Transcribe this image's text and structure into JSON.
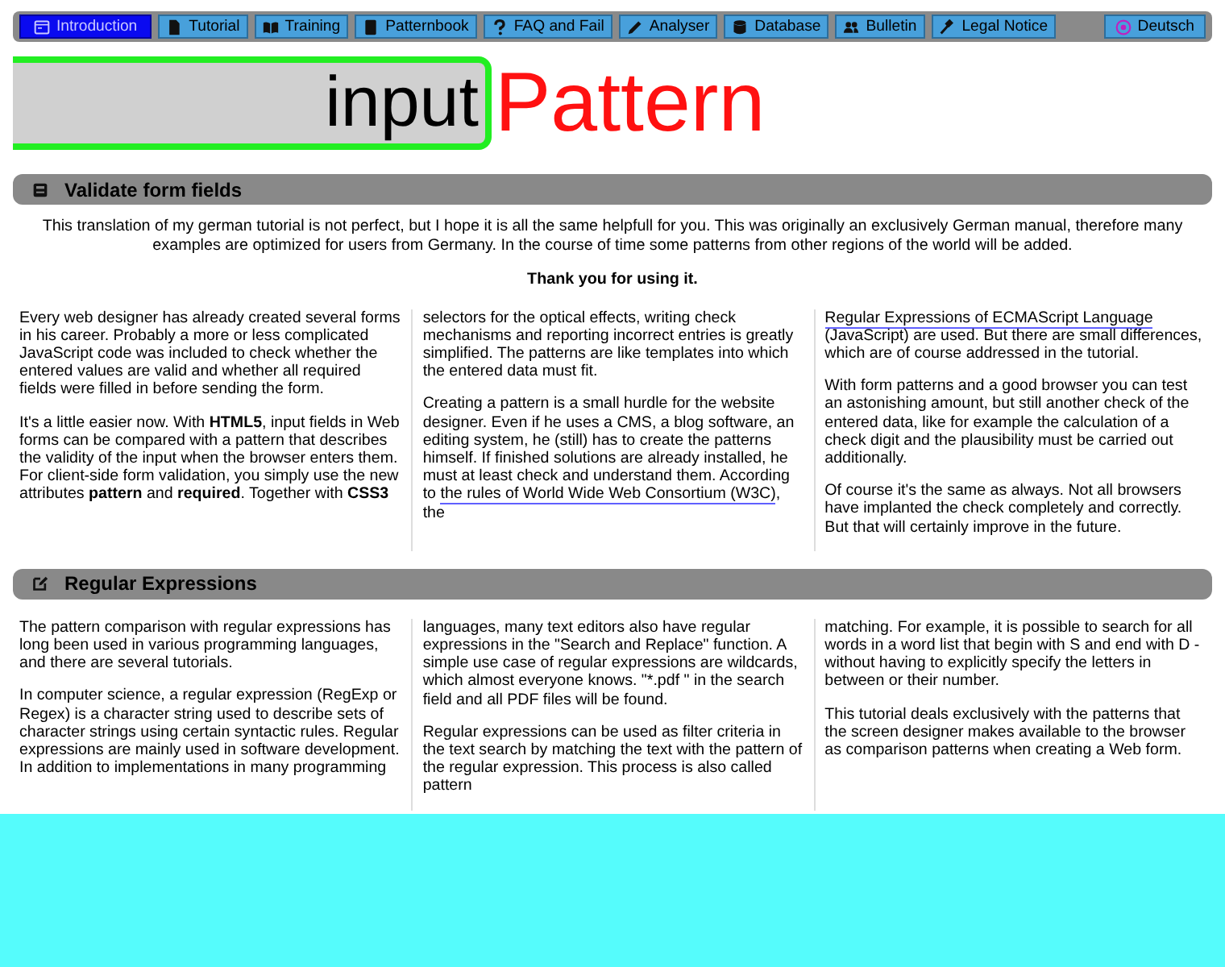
{
  "nav": {
    "items": [
      {
        "label": "Introduction",
        "selected": true
      },
      {
        "label": "Tutorial",
        "selected": false
      },
      {
        "label": "Training",
        "selected": false
      },
      {
        "label": "Patternbook",
        "selected": false
      },
      {
        "label": "FAQ and Fail",
        "selected": false
      },
      {
        "label": "Analyser",
        "selected": false
      },
      {
        "label": "Database",
        "selected": false
      },
      {
        "label": "Bulletin",
        "selected": false
      },
      {
        "label": "Legal Notice",
        "selected": false
      }
    ],
    "language": {
      "label": "Deutsch",
      "selected": false
    }
  },
  "logo": {
    "part_1": "input",
    "part_2": "Pattern"
  },
  "sections": [
    {
      "title": "Validate form fields",
      "intro": [
        "This translation of my german tutorial is not perfect, but I hope it is all the same helpfull for you. This was originally an exclusively German manual, therefore many examples are optimized for users from Germany. In the course of time some patterns from other regions of the world will be added.",
        "**Thank you for using it.**"
      ],
      "columns": [
        [
          [
            {
              "kind": "text",
              "text": "Every web designer has already created several forms in his career. Probably a more or less complicated JavaScript code was included to check whether the entered values are valid and whether all required fields were filled in before sending the form."
            }
          ],
          [
            {
              "kind": "text",
              "text": "It's a little easier now. With **HTML5**, input fields in Web forms can be compared with a pattern that describes the validity of the input when the browser enters them. For client-side form validation, you simply use the new attributes **pattern** and **required**. Together with **CSS3**"
            }
          ]
        ],
        [
          [
            {
              "kind": "text",
              "text": "selectors for the optical effects, writing check mechanisms and reporting incorrect entries is greatly simplified. The patterns are like templates into which the entered data must fit."
            }
          ],
          [
            {
              "kind": "text",
              "text": "Creating a pattern is a small hurdle for the website designer. Even if he uses a CMS, a blog software, an editing system, he (still) has to create the patterns himself. If finished solutions are already installed, he must at least check and understand them. According to "
            },
            {
              "kind": "link",
              "text": "the rules of World Wide Web Consortium (W3C)"
            },
            {
              "kind": "text",
              "text": ", the"
            }
          ]
        ],
        [
          [
            {
              "kind": "link",
              "text": "Regular Expressions of ECMAScript Language"
            },
            {
              "kind": "text",
              "text": " (JavaScript) are used. But there are small differences, which are of course addressed in the tutorial."
            }
          ],
          [
            {
              "kind": "text",
              "text": "With form patterns and a good browser you can test an astonishing amount, but still another check of the entered data, like for example the calculation of a check digit and the plausibility must be carried out additionally."
            }
          ],
          [
            {
              "kind": "text",
              "text": "Of course it's the same as always. Not all browsers have implanted the check completely and correctly. But that will certainly improve in the future."
            }
          ]
        ]
      ]
    },
    {
      "title": "Regular Expressions",
      "columns": [
        [
          [
            {
              "kind": "text",
              "text": "The pattern comparison with regular expressions has long been used in various programming languages, and there are several tutorials."
            }
          ],
          [
            {
              "kind": "text",
              "text": "In computer science, a regular expression (RegExp or Regex) is a character string used to describe sets of character strings using certain syntactic rules. Regular expressions are mainly used in software development. In addition to implementations in many programming"
            }
          ]
        ],
        [
          [
            {
              "kind": "text",
              "text": "languages, many text editors also have regular expressions in the \"Search and Replace\" function. A simple use case of regular expressions are wildcards, which almost everyone knows. \"*.pdf \" in the search field and all PDF files will be found."
            }
          ],
          [
            {
              "kind": "text",
              "text": "Regular expressions can be used as filter criteria in the text search by matching the text with the pattern of the regular expression. This process is also called pattern"
            }
          ]
        ],
        [
          [
            {
              "kind": "text",
              "text": "matching. For example, it is possible to search for all words in a word list that begin with S and end with D - without having to explicitly specify the letters in between or their number."
            }
          ],
          [
            {
              "kind": "text",
              "text": "This tutorial deals exclusively with the patterns that the screen designer makes available to the browser as comparison patterns when creating a Web form."
            }
          ]
        ]
      ]
    }
  ]
}
